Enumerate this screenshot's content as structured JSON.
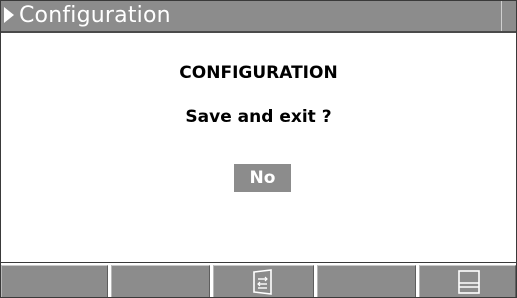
{
  "window": {
    "title": "Configuration"
  },
  "dialog": {
    "heading": "CONFIGURATION",
    "prompt": "Save and exit ?",
    "selected_option": "No"
  },
  "softkeys": [
    {
      "id": 1,
      "icon": "none"
    },
    {
      "id": 2,
      "icon": "none"
    },
    {
      "id": 3,
      "icon": "toggle-select-icon"
    },
    {
      "id": 4,
      "icon": "none"
    },
    {
      "id": 5,
      "icon": "exit-panel-icon"
    }
  ],
  "colors": {
    "bar_gray": "#8c8c8c",
    "text_white": "#ffffff",
    "text_black": "#000000"
  }
}
